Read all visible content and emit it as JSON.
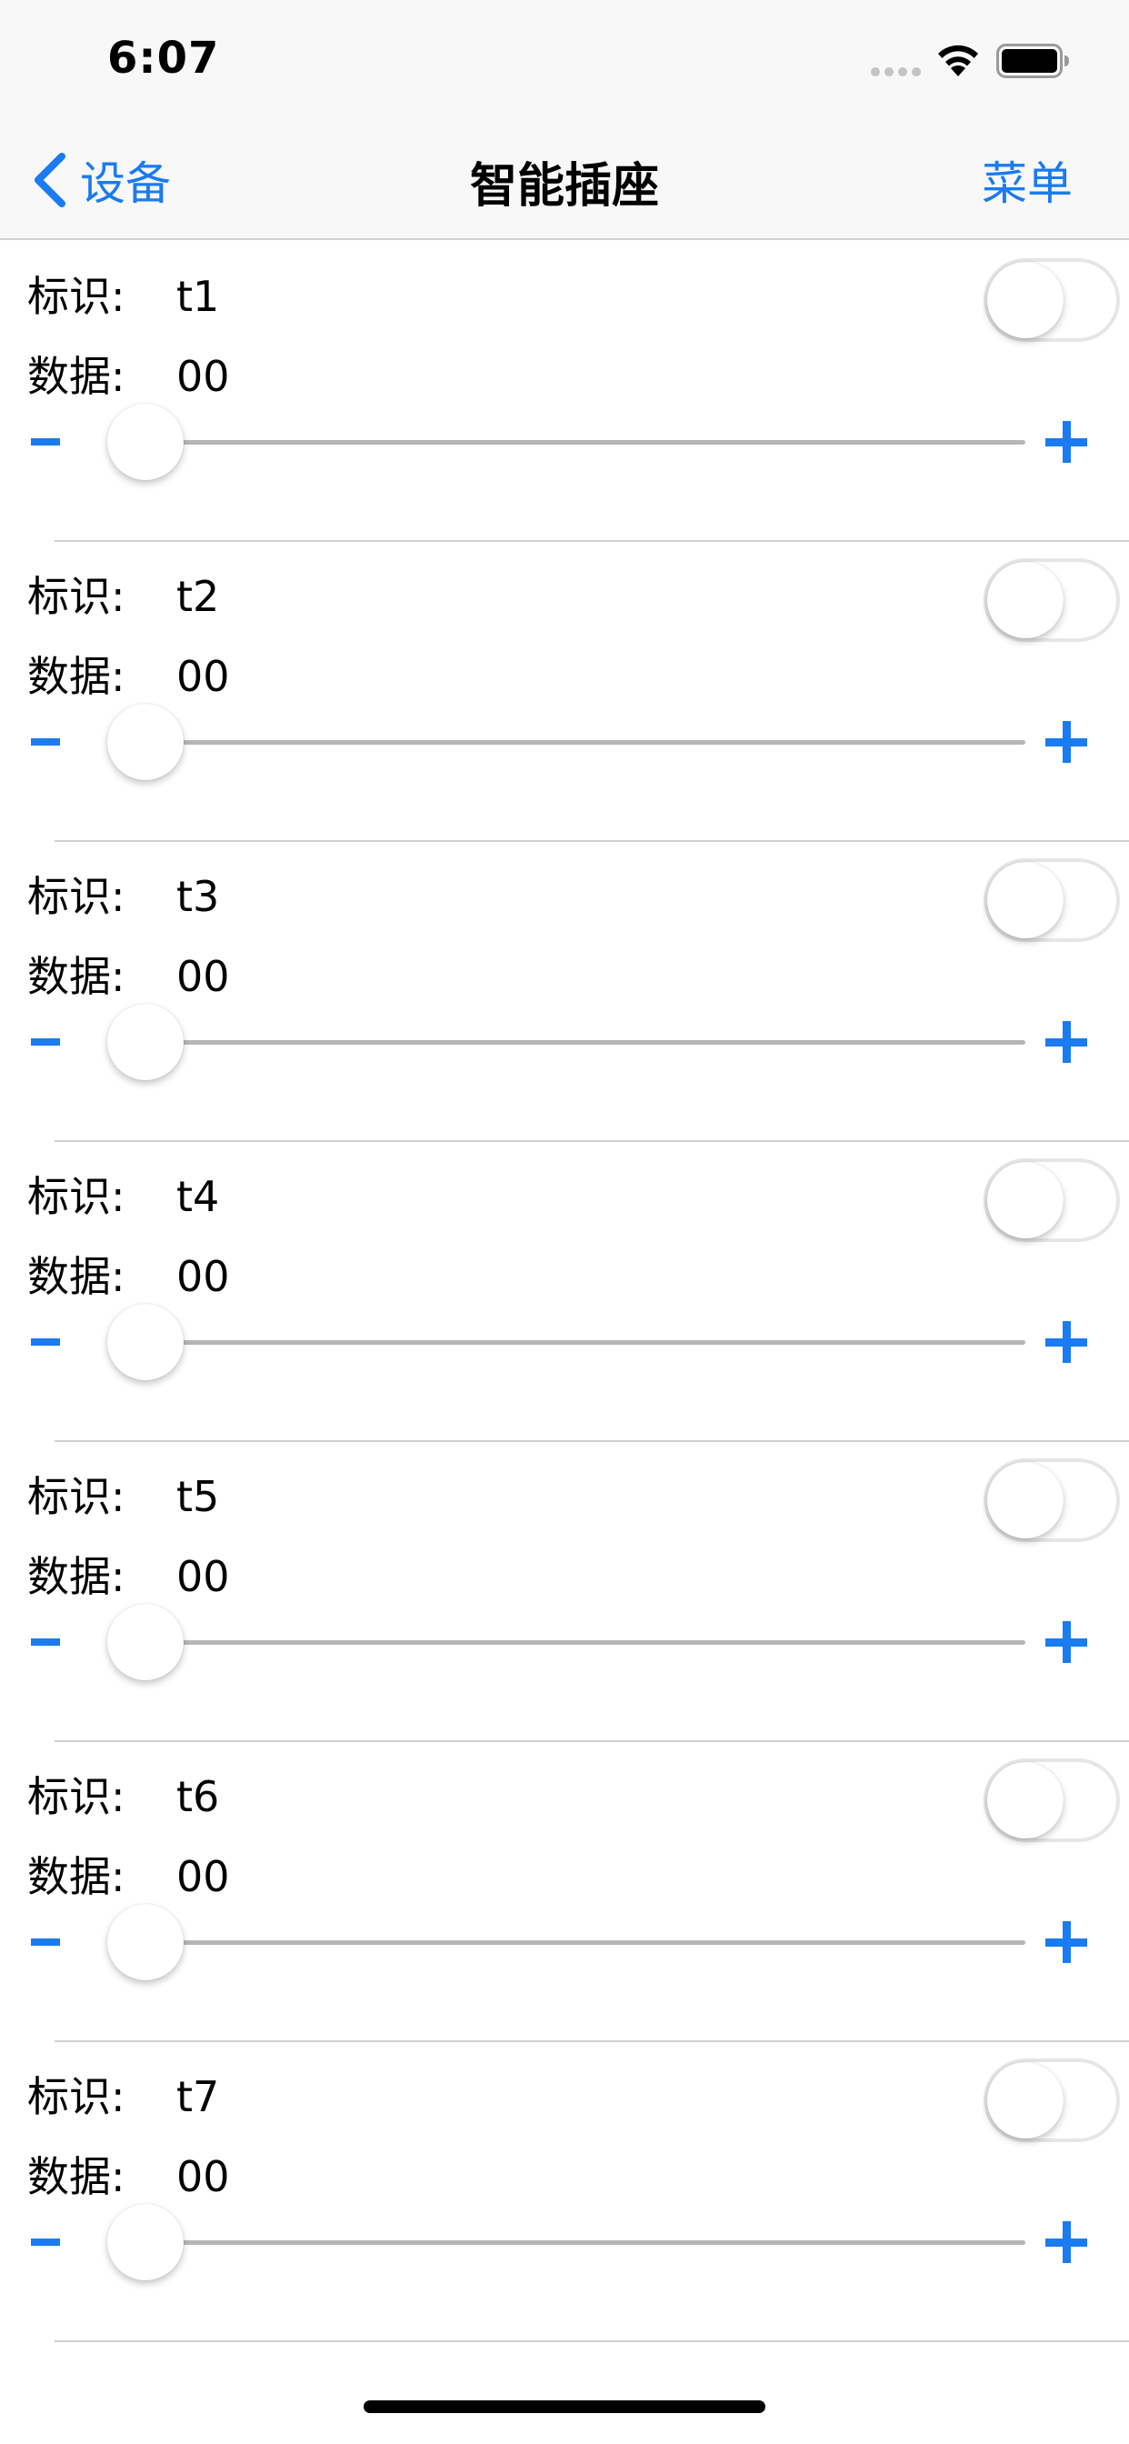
{
  "status_bar": {
    "time": "6:07",
    "signal_icon": "signal-dots-icon",
    "wifi_icon": "wifi-icon",
    "battery_icon": "battery-icon"
  },
  "nav": {
    "back_label": "设备",
    "back_icon": "chevron-left-icon",
    "title": "智能插座",
    "menu_label": "菜单"
  },
  "labels": {
    "id_label": "标识:",
    "data_label": "数据:"
  },
  "colors": {
    "accent": "#1b7bf0",
    "divider": "#d0d0d4",
    "track": "#b6b6b6"
  },
  "items": [
    {
      "id": "t1",
      "data": "00",
      "switch_on": false,
      "slider_value": 0
    },
    {
      "id": "t2",
      "data": "00",
      "switch_on": false,
      "slider_value": 0
    },
    {
      "id": "t3",
      "data": "00",
      "switch_on": false,
      "slider_value": 0
    },
    {
      "id": "t4",
      "data": "00",
      "switch_on": false,
      "slider_value": 0
    },
    {
      "id": "t5",
      "data": "00",
      "switch_on": false,
      "slider_value": 0
    },
    {
      "id": "t6",
      "data": "00",
      "switch_on": false,
      "slider_value": 0
    },
    {
      "id": "t7",
      "data": "00",
      "switch_on": false,
      "slider_value": 0
    }
  ]
}
